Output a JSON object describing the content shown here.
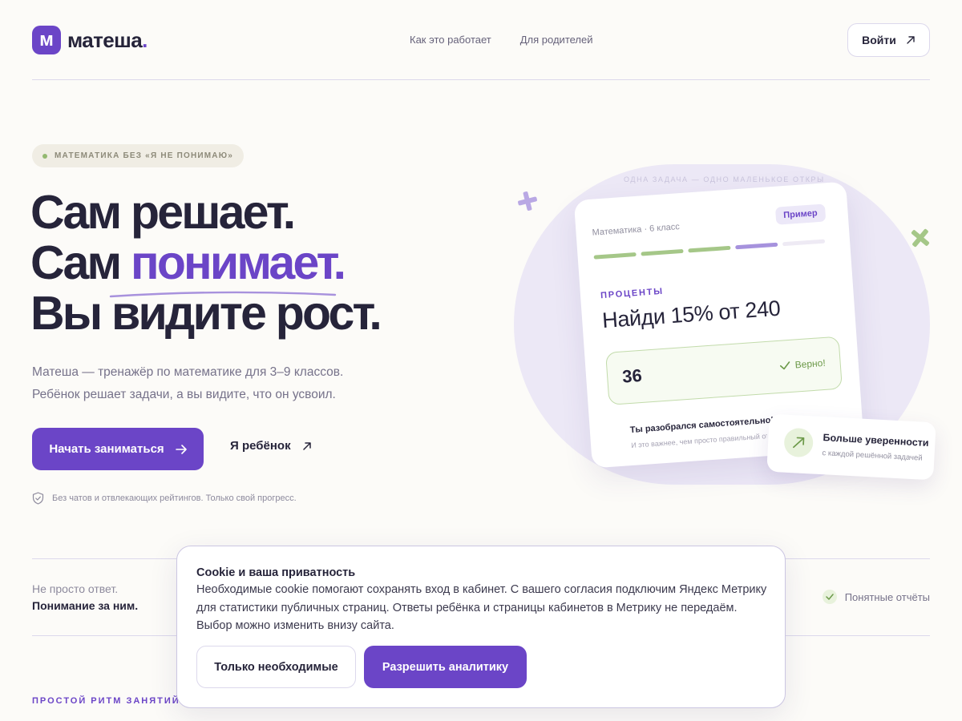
{
  "colors": {
    "accent": "#6b45c7",
    "success": "#93b870",
    "background": "#fcfbf8"
  },
  "header": {
    "logo_letter": "м",
    "logo_text": "матеша",
    "logo_dot": ".",
    "nav": [
      "Как это работает",
      "Для родителей"
    ],
    "login_label": "Войти",
    "login_icon": "arrow-up-right-icon"
  },
  "hero": {
    "badge": "МАТЕМАТИКА БЕЗ «Я НЕ ПОНИМАЮ»",
    "headline": {
      "line1": "Сам решает.",
      "line2_prefix": "Сам ",
      "line2_accent": "понимает.",
      "line3": "Вы видите рост."
    },
    "lead": [
      "Матеша — тренажёр по математике для 3–9 классов.",
      "Ребёнок решает задачи, а вы видите, что он усвоил."
    ],
    "primary_cta": "Начать заниматься",
    "secondary_cta": "Я ребёнок",
    "note": "Без чатов и отвлекающих рейтингов. Только свой прогресс.",
    "note_icon": "shield-check-icon"
  },
  "illustration": {
    "caption": "ОДНА ЗАДАЧА — ОДНО МАЛЕНЬКОЕ ОТКРЫТИЕ",
    "card": {
      "meta": "Математика · 6 класс",
      "tag": "Пример",
      "progress_segments": [
        "done",
        "done",
        "done",
        "current",
        "todo"
      ],
      "topic": "ПРОЦЕНТЫ",
      "question": "Найди 15% от 240",
      "answer": "36",
      "status": "Верно!",
      "praise": "Ты разобрался самостоятельно!",
      "praise_sub": "И это важнее, чем просто правильный ответ"
    },
    "growth": {
      "title": "Больше уверенности",
      "sub": "с каждой решённой задачей"
    }
  },
  "strip": {
    "line1": "Не просто ответ.",
    "line2": "Понимание за ним.",
    "item": "Понятные отчёты"
  },
  "section_label": "ПРОСТОЙ РИТМ ЗАНЯТИЙ",
  "cookie": {
    "title": "Cookie и ваша приватность",
    "text": "Необходимые cookie помогают сохранять вход в кабинет. С вашего согласия подключим Яндекс Метрику для статистики публичных страниц. Ответы ребёнка и страницы кабинетов в Метрику не передаём. Выбор можно изменить внизу сайта.",
    "necessary_only": "Только необходимые",
    "allow": "Разрешить аналитику"
  }
}
